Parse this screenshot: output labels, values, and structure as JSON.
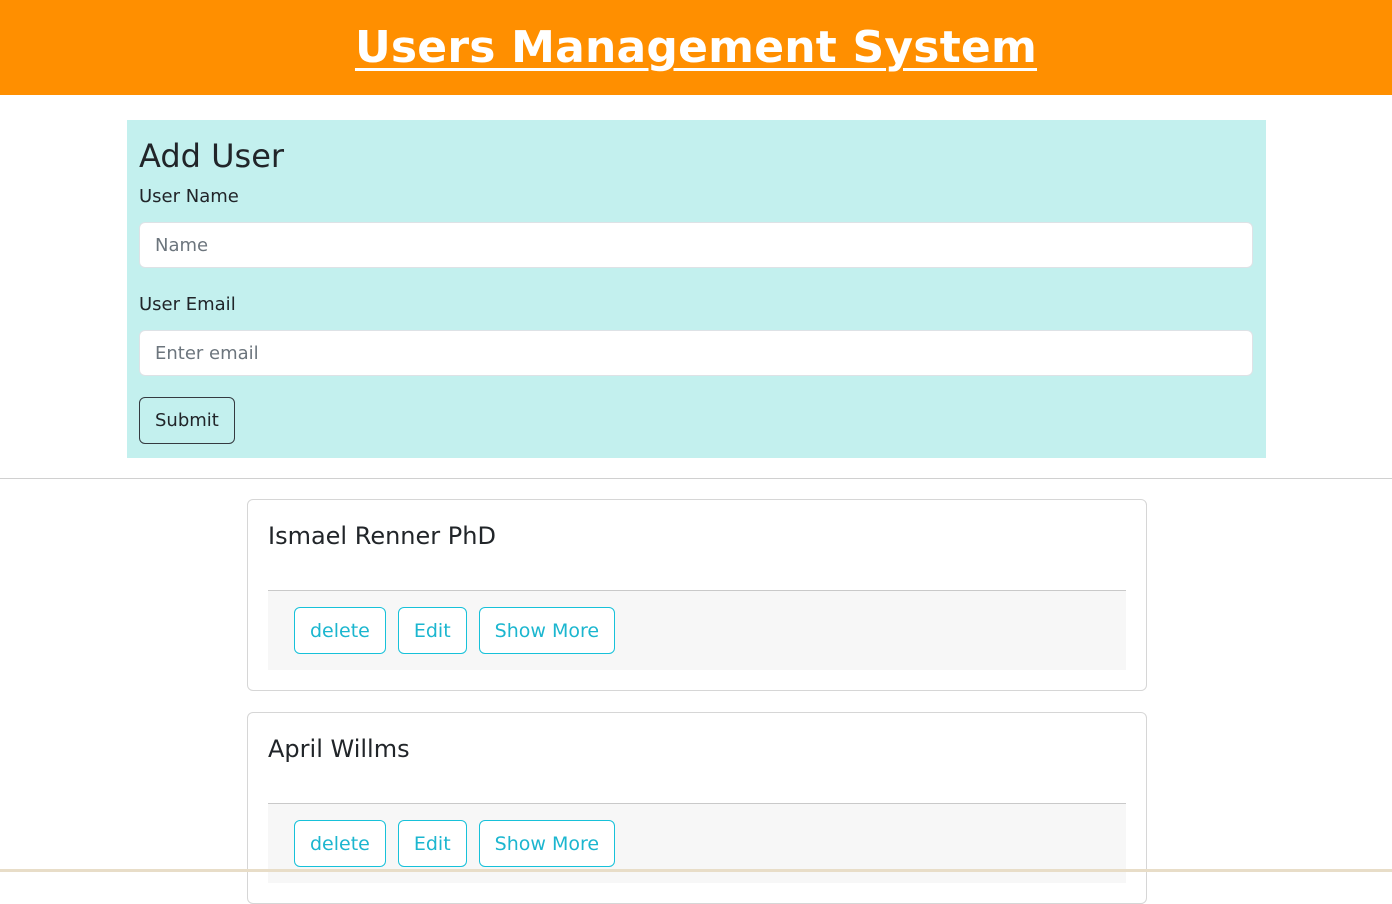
{
  "header": {
    "title": "Users Management System"
  },
  "form": {
    "heading": "Add User",
    "name_label": "User Name",
    "name_placeholder": "Name",
    "email_label": "User Email",
    "email_placeholder": "Enter email",
    "submit_label": "Submit"
  },
  "users": [
    {
      "name": "Ismael Renner PhD",
      "delete_label": "delete",
      "edit_label": "Edit",
      "show_more_label": "Show More"
    },
    {
      "name": "April Willms",
      "delete_label": "delete",
      "edit_label": "Edit",
      "show_more_label": "Show More"
    }
  ],
  "colors": {
    "header_bg": "#ff8f00",
    "form_bg": "#c3f0ee",
    "info_accent": "#17c1d9"
  }
}
